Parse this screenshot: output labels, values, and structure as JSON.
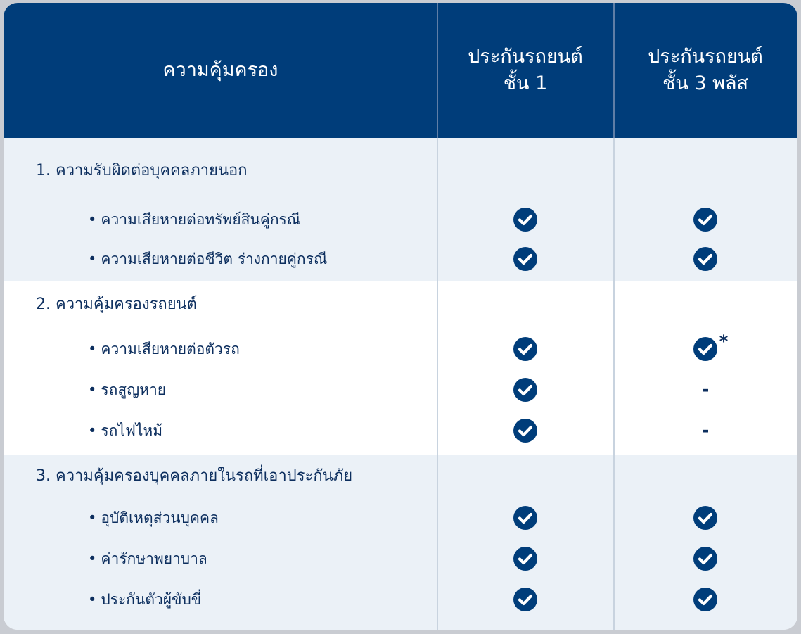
{
  "header": {
    "col0": "ความคุ้มครอง",
    "col1": "ประกันรถยนต์\nชั้น 1",
    "col2": "ประกันรถยนต์\nชั้น 3 พลัส"
  },
  "sections": [
    {
      "title": "1. ความรับผิดต่อบุคคลภายนอก",
      "rows": [
        {
          "bullet": "•",
          "label": "ความเสียหายต่อทรัพย์สินคู่กรณี",
          "class1": "check",
          "class3plus": "check"
        },
        {
          "bullet": "•",
          "label": "ความเสียหายต่อชีวิต ร่างกายคู่กรณี",
          "class1": "check",
          "class3plus": "check"
        }
      ]
    },
    {
      "title": "2. ความคุ้มครองรถยนต์",
      "rows": [
        {
          "bullet": "•",
          "label": "ความเสียหายต่อตัวรถ",
          "class1": "check",
          "class3plus": "check",
          "class3plus_note": "*"
        },
        {
          "bullet": "•",
          "label": "รถสูญหาย",
          "class1": "check",
          "class3plus": "-"
        },
        {
          "bullet": "•",
          "label": "รถไฟไหม้",
          "class1": "check",
          "class3plus": "-"
        }
      ]
    },
    {
      "title": "3. ความคุ้มครองบุคคลภายในรถที่เอาประกันภัย",
      "rows": [
        {
          "bullet": "•",
          "label": "อุบัติเหตุส่วนบุคคล",
          "class1": "check",
          "class3plus": "check"
        },
        {
          "bullet": "•",
          "label": "ค่ารักษาพยาบาล",
          "class1": "check",
          "class3plus": "check"
        },
        {
          "bullet": "•",
          "label": "ประกันตัวผู้ขับขี่",
          "class1": "check",
          "class3plus": "check"
        }
      ]
    }
  ],
  "colors": {
    "header_bg": "#003d7a",
    "section_shade": "#ebf1f7",
    "text": "#0c2e5e",
    "check_fill": "#003d7a"
  },
  "icons": {
    "check": "check-circle-icon",
    "dash": "dash-glyph"
  }
}
